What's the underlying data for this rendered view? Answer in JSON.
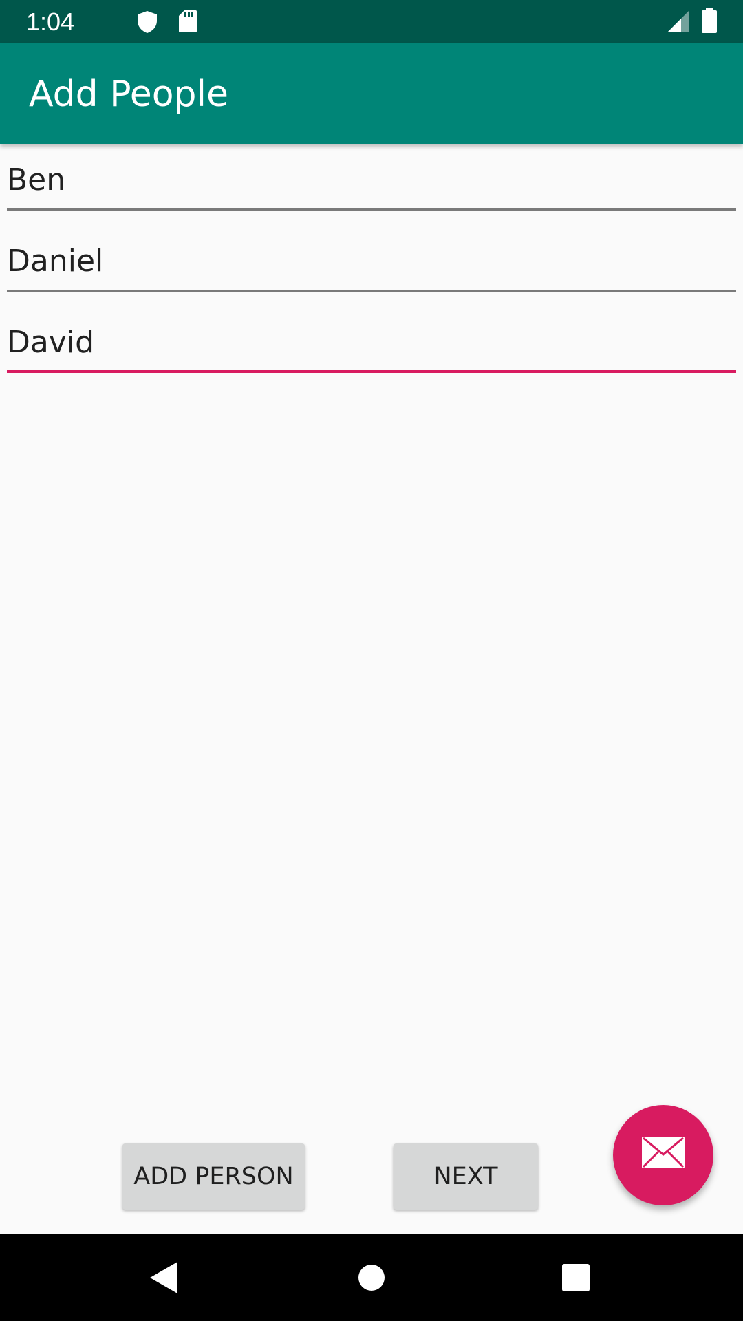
{
  "status_bar": {
    "time": "1:04",
    "icons": [
      "shield-icon",
      "sd-card-icon",
      "signal-icon",
      "battery-icon"
    ]
  },
  "app_bar": {
    "title": "Add People"
  },
  "form": {
    "fields": [
      {
        "value": "Ben"
      },
      {
        "value": "Daniel"
      },
      {
        "value": "David",
        "focused": true
      }
    ]
  },
  "actions": {
    "add_person_label": "ADD PERSON",
    "next_label": "NEXT"
  },
  "fab": {
    "icon": "email-icon"
  },
  "nav_bar": {
    "icons": [
      "back-icon",
      "home-icon",
      "recents-icon"
    ]
  },
  "colors": {
    "status_bar": "#00574b",
    "app_bar": "#008577",
    "accent": "#d81b60",
    "background": "#fafafa",
    "button": "#d6d7d7"
  }
}
